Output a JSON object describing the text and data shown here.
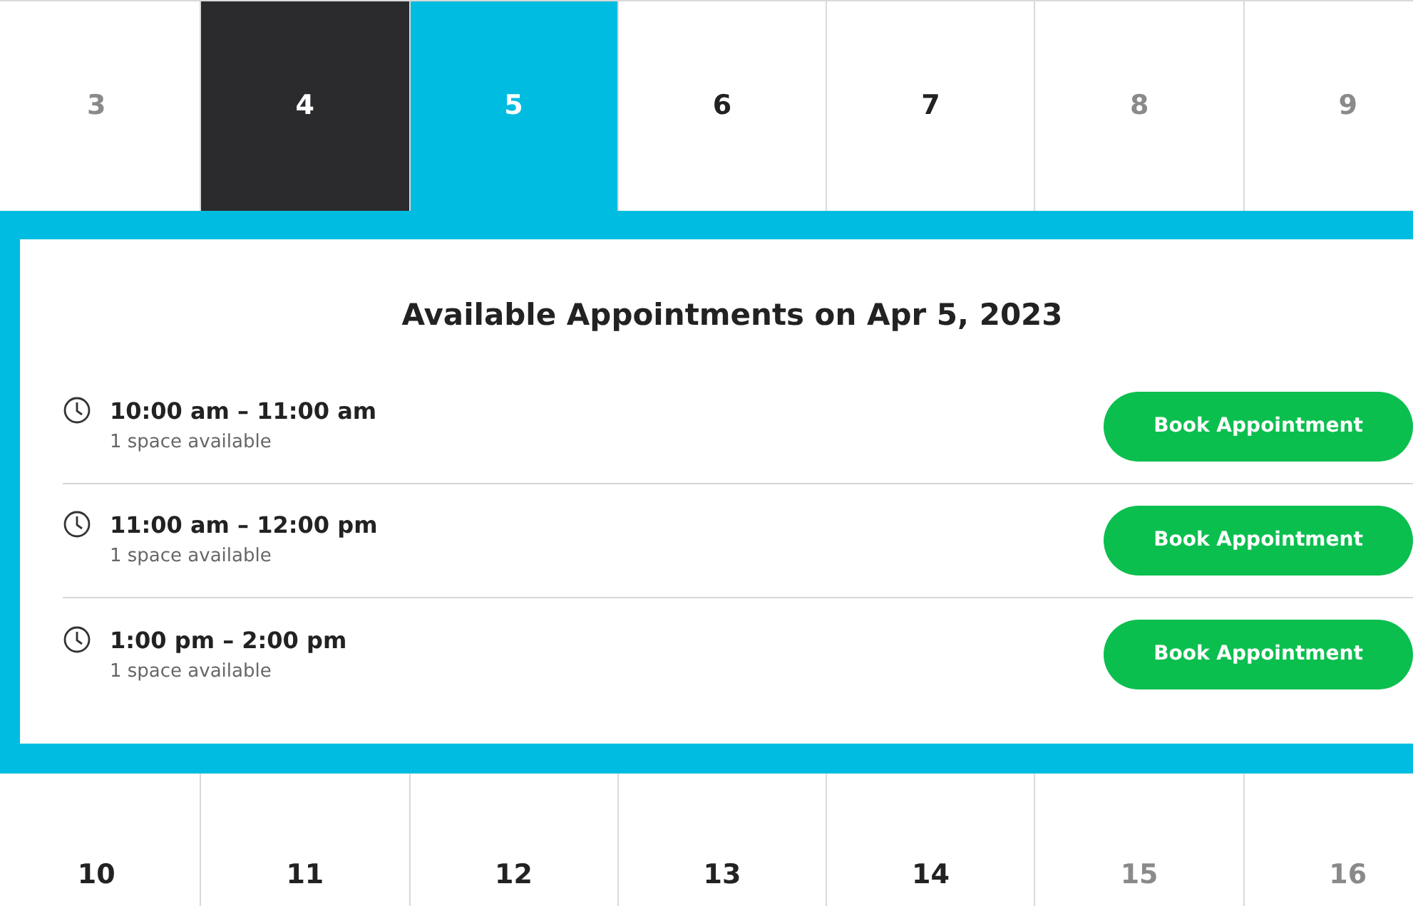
{
  "week_1": [
    {
      "day": "3",
      "muted": true,
      "today": false,
      "selected": false
    },
    {
      "day": "4",
      "muted": false,
      "today": true,
      "selected": false
    },
    {
      "day": "5",
      "muted": false,
      "today": false,
      "selected": true
    },
    {
      "day": "6",
      "muted": false,
      "today": false,
      "selected": false
    },
    {
      "day": "7",
      "muted": false,
      "today": false,
      "selected": false
    },
    {
      "day": "8",
      "muted": true,
      "today": false,
      "selected": false
    },
    {
      "day": "9",
      "muted": true,
      "today": false,
      "selected": false
    }
  ],
  "appointments": {
    "title": "Available Appointments on Apr 5, 2023",
    "slots": [
      {
        "time": "10:00 am – 11:00 am",
        "availability": "1 space available",
        "button": "Book Appointment"
      },
      {
        "time": "11:00 am – 12:00 pm",
        "availability": "1 space available",
        "button": "Book Appointment"
      },
      {
        "time": "1:00 pm – 2:00 pm",
        "availability": "1 space available",
        "button": "Book Appointment"
      }
    ]
  },
  "week_2": [
    {
      "day": "10",
      "muted": false,
      "today": false,
      "selected": false
    },
    {
      "day": "11",
      "muted": false,
      "today": false,
      "selected": false
    },
    {
      "day": "12",
      "muted": false,
      "today": false,
      "selected": false
    },
    {
      "day": "13",
      "muted": false,
      "today": false,
      "selected": false
    },
    {
      "day": "14",
      "muted": false,
      "today": false,
      "selected": false
    },
    {
      "day": "15",
      "muted": true,
      "today": false,
      "selected": false
    },
    {
      "day": "16",
      "muted": true,
      "today": false,
      "selected": false
    }
  ]
}
